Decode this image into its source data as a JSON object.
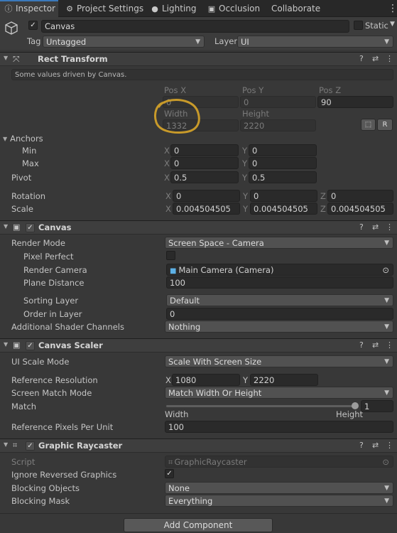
{
  "tabs": [
    {
      "label": "Inspector",
      "icon": "info-icon"
    },
    {
      "label": "Project Settings",
      "icon": "gear-icon"
    },
    {
      "label": "Lighting",
      "icon": "bulb-icon"
    },
    {
      "label": "Occlusion",
      "icon": "occlusion-icon"
    },
    {
      "label": "Collaborate",
      "icon": ""
    }
  ],
  "object": {
    "name": "Canvas",
    "static_label": "Static",
    "tag_label": "Tag",
    "tag_value": "Untagged",
    "layer_label": "Layer",
    "layer_value": "UI"
  },
  "rect_transform": {
    "title": "Rect Transform",
    "notice": "Some values driven by Canvas.",
    "posx_label": "Pos X",
    "posy_label": "Pos Y",
    "posz_label": "Pos Z",
    "posx": "0",
    "posy": "0",
    "posz": "90",
    "width_label": "Width",
    "height_label": "Height",
    "width": "1332",
    "height": "2220",
    "r_button": "R",
    "anchors_label": "Anchors",
    "min_label": "Min",
    "max_label": "Max",
    "min_x": "0",
    "min_y": "0",
    "max_x": "0",
    "max_y": "0",
    "pivot_label": "Pivot",
    "pivot_x": "0.5",
    "pivot_y": "0.5",
    "rotation_label": "Rotation",
    "rot_x": "0",
    "rot_y": "0",
    "rot_z": "0",
    "scale_label": "Scale",
    "scale_x": "0.004504505",
    "scale_y": "0.004504505",
    "scale_z": "0.004504505",
    "x": "X",
    "y": "Y",
    "z": "Z"
  },
  "canvas": {
    "title": "Canvas",
    "render_mode_label": "Render Mode",
    "render_mode": "Screen Space - Camera",
    "pixel_perfect_label": "Pixel Perfect",
    "render_camera_label": "Render Camera",
    "render_camera": "Main Camera (Camera)",
    "plane_distance_label": "Plane Distance",
    "plane_distance": "100",
    "sorting_layer_label": "Sorting Layer",
    "sorting_layer": "Default",
    "order_label": "Order in Layer",
    "order": "0",
    "shader_label": "Additional Shader Channels",
    "shader": "Nothing"
  },
  "scaler": {
    "title": "Canvas Scaler",
    "mode_label": "UI Scale Mode",
    "mode": "Scale With Screen Size",
    "ref_res_label": "Reference Resolution",
    "ref_x": "1080",
    "ref_y": "2220",
    "match_mode_label": "Screen Match Mode",
    "match_mode": "Match Width Or Height",
    "match_label": "Match",
    "match_value": "1",
    "width_label": "Width",
    "height_label": "Height",
    "ppu_label": "Reference Pixels Per Unit",
    "ppu": "100"
  },
  "raycaster": {
    "title": "Graphic Raycaster",
    "script_label": "Script",
    "script": "GraphicRaycaster",
    "ignore_label": "Ignore Reversed Graphics",
    "blocking_objects_label": "Blocking Objects",
    "blocking_objects": "None",
    "blocking_mask_label": "Blocking Mask",
    "blocking_mask": "Everything"
  },
  "add_component": "Add Component",
  "colors": {
    "annotation": "#c89a2a",
    "accent": "#3a79bb"
  }
}
